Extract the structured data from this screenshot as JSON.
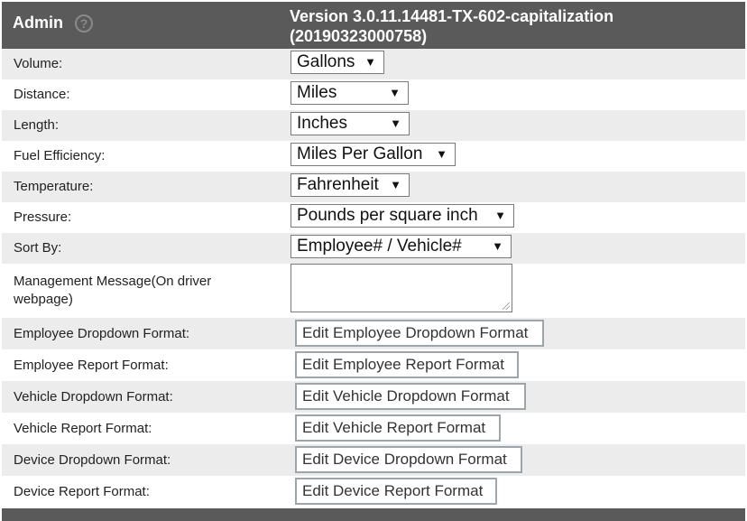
{
  "header": {
    "title": "Admin",
    "version_line1": "Version 3.0.11.14481-TX-602-capitalization",
    "version_line2": "(20190323000758)"
  },
  "settings": [
    {
      "label": "Volume:",
      "value": "Gallons"
    },
    {
      "label": "Distance:",
      "value": "Miles"
    },
    {
      "label": "Length:",
      "value": "Inches"
    },
    {
      "label": "Fuel Efficiency:",
      "value": "Miles Per Gallon"
    },
    {
      "label": "Temperature:",
      "value": "Fahrenheit"
    },
    {
      "label": "Pressure:",
      "value": "Pounds per square inch"
    },
    {
      "label": "Sort By:",
      "value": "Employee# / Vehicle#"
    }
  ],
  "management_message": {
    "label_line1": "Management Message(On driver",
    "label_line2": "webpage)",
    "value": ""
  },
  "formats": [
    {
      "label": "Employee Dropdown Format:",
      "button": "Edit Employee Dropdown Format"
    },
    {
      "label": "Employee Report Format:",
      "button": "Edit Employee Report Format"
    },
    {
      "label": "Vehicle Dropdown Format:",
      "button": "Edit Vehicle Dropdown Format"
    },
    {
      "label": "Vehicle Report Format:",
      "button": "Edit Vehicle Report Format"
    },
    {
      "label": "Device Dropdown Format:",
      "button": "Edit Device Dropdown Format"
    },
    {
      "label": "Device Report Format:",
      "button": "Edit Device Report Format"
    }
  ],
  "icons": {
    "help": "question-circle-icon",
    "dropdown": "triangle-down-icon"
  },
  "colors": {
    "header_bg": "#5a5a5a",
    "row_alt": "#ececec",
    "button_border": "#9aa6ac"
  }
}
